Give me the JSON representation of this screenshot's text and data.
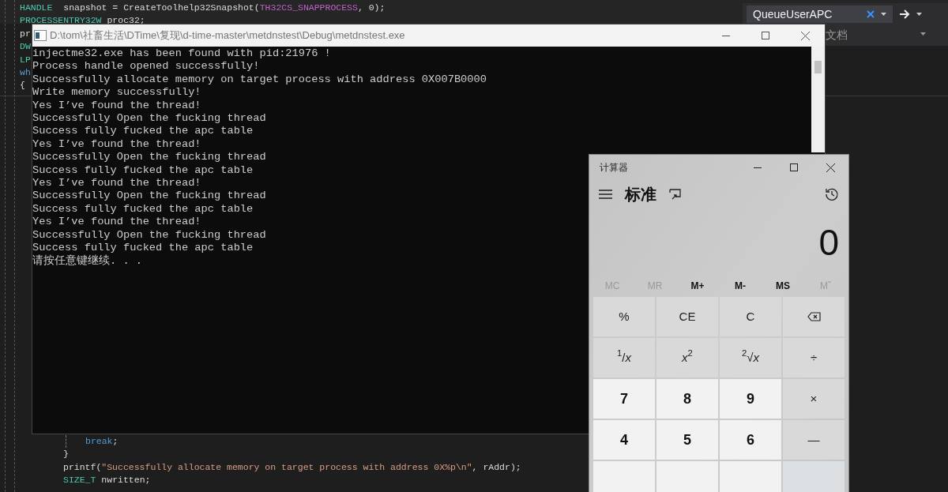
{
  "editor": {
    "code_top": [
      {
        "segments": [
          {
            "kind": "type",
            "text": "HANDLE"
          },
          {
            "kind": "plain",
            "text": "  snapshot = CreateToolhelp32Snapshot("
          },
          {
            "kind": "macro",
            "text": "TH32CS_SNAPPROCESS"
          },
          {
            "kind": "plain",
            "text": ", 0);"
          }
        ]
      },
      {
        "segments": [
          {
            "kind": "type",
            "text": "PROCESSENTRY32W"
          },
          {
            "kind": "plain",
            "text": " proc32;"
          }
        ]
      },
      {
        "segments": [
          {
            "kind": "plain",
            "text": "pr"
          }
        ]
      },
      {
        "segments": [
          {
            "kind": "type",
            "text": "DW"
          }
        ]
      },
      {
        "segments": [
          {
            "kind": "type",
            "text": "LP"
          }
        ]
      },
      {
        "segments": [
          {
            "kind": "keyword",
            "text": "wh"
          }
        ]
      },
      {
        "segments": [
          {
            "kind": "plain",
            "text": "{"
          }
        ]
      }
    ],
    "code_bottom": [
      {
        "indented": true,
        "segments": [
          {
            "kind": "keyword",
            "text": "break"
          },
          {
            "kind": "plain",
            "text": ";"
          }
        ]
      },
      {
        "indented": false,
        "segments": [
          {
            "kind": "plain",
            "text": "}"
          }
        ]
      },
      {
        "indented": false,
        "segments": [
          {
            "kind": "plain",
            "text": "printf("
          },
          {
            "kind": "string",
            "text": "\"Successfully allocate memory on target process with address 0X%p\\n\""
          },
          {
            "kind": "plain",
            "text": ", rAddr);"
          }
        ]
      },
      {
        "indented": false,
        "segments": [
          {
            "kind": "type",
            "text": "SIZE_T"
          },
          {
            "kind": "plain",
            "text": " nwritten;"
          }
        ]
      }
    ],
    "search": {
      "value": "QueueUserAPC"
    },
    "panel_label": "文档"
  },
  "console": {
    "title": "D:\\tom\\社畜生活\\DTime\\复现\\d-time-master\\metdnstest\\Debug\\metdnstest.exe",
    "lines": [
      "injectme32.exe has been found with pid:21976 !",
      "Process handle opened successfully!",
      "Successfully allocate memory on target process with address 0X007B0000",
      "Write memory successfully!",
      "Yes I’ve found the thread!",
      "Successfully Open the fucking thread",
      "Success fully fucked the apc table",
      "Yes I’ve found the thread!",
      "Successfully Open the fucking thread",
      "Success fully fucked the apc table",
      "Yes I’ve found the thread!",
      "Successfully Open the fucking thread",
      "Success fully fucked the apc table",
      "Yes I’ve found the thread!",
      "Successfully Open the fucking thread",
      "Success fully fucked the apc table",
      "请按任意键继续. . ."
    ]
  },
  "calculator": {
    "title": "计算器",
    "mode": "标准",
    "display": "0",
    "memory": [
      {
        "label": "MC",
        "disabled": true
      },
      {
        "label": "MR",
        "disabled": true
      },
      {
        "label": "M+",
        "disabled": false
      },
      {
        "label": "M-",
        "disabled": false
      },
      {
        "label": "MS",
        "disabled": false
      },
      {
        "label": "Mˇ",
        "disabled": true
      }
    ],
    "keys": [
      {
        "kind": "op",
        "label": "%"
      },
      {
        "kind": "op",
        "label": "CE"
      },
      {
        "kind": "op",
        "label": "C"
      },
      {
        "kind": "backspace"
      },
      {
        "kind": "op",
        "label": "$^{1}$/*x*"
      },
      {
        "kind": "op",
        "label": "*x*$^{2}$"
      },
      {
        "kind": "op",
        "label": "$^{2}$√*x*"
      },
      {
        "kind": "op",
        "label": "÷"
      },
      {
        "kind": "digit",
        "label": "7"
      },
      {
        "kind": "digit",
        "label": "8"
      },
      {
        "kind": "digit",
        "label": "9"
      },
      {
        "kind": "op",
        "label": "×"
      },
      {
        "kind": "digit",
        "label": "4"
      },
      {
        "kind": "digit",
        "label": "5"
      },
      {
        "kind": "digit",
        "label": "6"
      },
      {
        "kind": "op",
        "label": "—"
      },
      {
        "kind": "blank"
      },
      {
        "kind": "blank"
      },
      {
        "kind": "blank"
      },
      {
        "kind": "blankop"
      }
    ]
  }
}
